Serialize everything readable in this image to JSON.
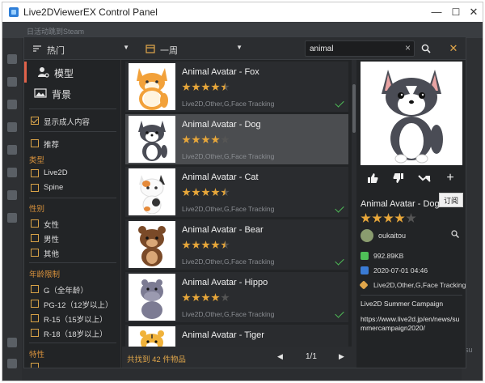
{
  "window": {
    "title": "Live2DViewerEX Control Panel",
    "minimize": "—",
    "maximize": "☐",
    "close": "✕"
  },
  "background": {
    "top_text": "日活动跳到Steam",
    "right_text": "su",
    "right_text2": "s/"
  },
  "toolbar": {
    "sort_label": "热门",
    "time_label": "一周",
    "search_value": "animal",
    "search_clear": "×"
  },
  "categories": [
    {
      "label": "模型",
      "active": true
    },
    {
      "label": "背景",
      "active": false
    }
  ],
  "filters": {
    "adult_content": "显示成人内容",
    "recommend": "推荐",
    "type_head": "类型",
    "type_options": [
      "Live2D",
      "Spine"
    ],
    "gender_head": "性别",
    "gender_options": [
      "女性",
      "男性",
      "其他"
    ],
    "age_head": "年龄限制",
    "age_options": [
      "G（全年龄）",
      "PG-12（12岁以上）",
      "R-15（15岁以上）",
      "R-18（18岁以上）"
    ],
    "feature_head": "特性"
  },
  "items": [
    {
      "title": "Animal Avatar - Fox",
      "tags": "Live2D,Other,G,Face Tracking",
      "rating": 4.5,
      "subscribed": true,
      "selected": false
    },
    {
      "title": "Animal Avatar - Dog",
      "tags": "Live2D,Other,G,Face Tracking",
      "rating": 4,
      "subscribed": false,
      "selected": true
    },
    {
      "title": "Animal Avatar - Cat",
      "tags": "Live2D,Other,G,Face Tracking",
      "rating": 4.5,
      "subscribed": true,
      "selected": false
    },
    {
      "title": "Animal Avatar - Bear",
      "tags": "Live2D,Other,G,Face Tracking",
      "rating": 4.5,
      "subscribed": true,
      "selected": false
    },
    {
      "title": "Animal Avatar - Hippo",
      "tags": "Live2D,Other,G,Face Tracking",
      "rating": 4,
      "subscribed": true,
      "selected": false
    },
    {
      "title": "Animal Avatar - Tiger",
      "tags": "",
      "rating": 0,
      "subscribed": false,
      "selected": false
    }
  ],
  "footer": {
    "count_text": "共找到 42 件物品",
    "prev": "◀",
    "page": "1/1",
    "next": "▶"
  },
  "detail": {
    "title": "Animal Avatar - Dog",
    "rating": 4,
    "author": "oukaitou",
    "size": "992.89KB",
    "date": "2020-07-01 04:46",
    "tags": "Live2D,Other,G,Face Tracking",
    "desc_title": "Live2D Summer Campaign",
    "desc_link": "https://www.live2d.jp/en/news/summercampaign2020/",
    "tooltip": "订阅"
  },
  "colors": {
    "accent": "#e0624a",
    "section": "#d9923c",
    "star": "#e8a73a",
    "check": "#4fbf58"
  }
}
